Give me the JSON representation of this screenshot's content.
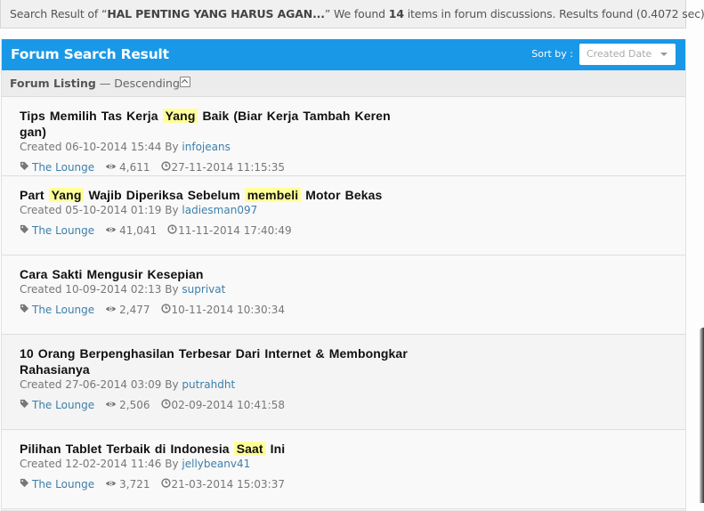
{
  "summary": {
    "prefix": "Search Result of “",
    "query": "HAL PENTING YANG HARUS AGAN...",
    "mid": "” We found ",
    "count": "14",
    "suffix": " items in forum discussions. Results found (0.4072 sec)"
  },
  "panel": {
    "title": "Forum Search Result",
    "sort_label": "Sort by :",
    "sort_value": "Created Date"
  },
  "listing": {
    "label": "Forum Listing",
    "order": " — Descending"
  },
  "items": [
    {
      "title_parts": [
        {
          "text": "Tips Memilih Tas Kerja ",
          "hl": false
        },
        {
          "text": "Yang",
          "hl": true
        },
        {
          "text": " Baik (Biar Kerja Tambah Keren gan)",
          "hl": false
        }
      ],
      "created": "Created 06-10-2014 15:44 By ",
      "author": "infojeans",
      "forum": "The Lounge",
      "views": "4,611",
      "last_post": "27-11-2014 11:15:35"
    },
    {
      "title_parts": [
        {
          "text": "Part ",
          "hl": false
        },
        {
          "text": "Yang",
          "hl": true
        },
        {
          "text": " Wajib Diperiksa Sebelum ",
          "hl": false
        },
        {
          "text": "membeli",
          "hl": true
        },
        {
          "text": " Motor Bekas",
          "hl": false
        }
      ],
      "created": "Created 05-10-2014 01:19 By ",
      "author": "ladiesman097",
      "forum": "The Lounge",
      "views": "41,041",
      "last_post": "11-11-2014 17:40:49"
    },
    {
      "title_parts": [
        {
          "text": "Cara Sakti Mengusir Kesepian",
          "hl": false
        }
      ],
      "created": "Created 10-09-2014 02:13 By ",
      "author": "suprivat",
      "forum": "The Lounge",
      "views": "2,477",
      "last_post": "10-11-2014 10:30:34"
    },
    {
      "title_parts": [
        {
          "text": "10 Orang Berpenghasilan Terbesar Dari Internet & Membongkar Rahasianya",
          "hl": false
        }
      ],
      "created": "Created 27-06-2014 03:09 By ",
      "author": "putrahdht",
      "forum": "The Lounge",
      "views": "2,506",
      "last_post": "02-09-2014 10:41:58"
    },
    {
      "title_parts": [
        {
          "text": "Pilihan Tablet Terbaik di Indonesia ",
          "hl": false
        },
        {
          "text": "Saat",
          "hl": true
        },
        {
          "text": " Ini",
          "hl": false
        }
      ],
      "created": "Created 12-02-2014 11:46 By ",
      "author": "jellybeanv41",
      "forum": "The Lounge",
      "views": "3,721",
      "last_post": "21-03-2014 15:03:37"
    }
  ],
  "icons": {
    "tag": "tag-icon",
    "views": "eye-icon",
    "clock": "clock-icon",
    "collapse": "chevron-up-icon",
    "dropdown": "caret-down-icon"
  },
  "colors": {
    "header_blue": "#1a98e8",
    "link_blue": "#3d7fab",
    "highlight": "#ffff99"
  }
}
